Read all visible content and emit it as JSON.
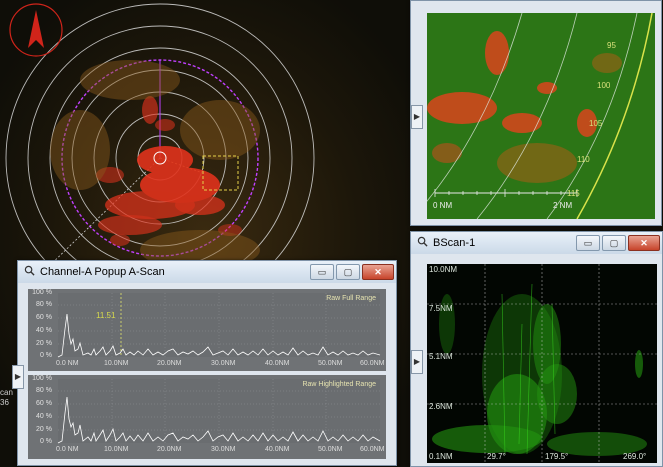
{
  "ppi": {
    "corner_labels": [
      "can",
      "36"
    ]
  },
  "ppi_zoom": {
    "range_labels": [
      "95",
      "100",
      "105",
      "110",
      "115"
    ],
    "scale_start": "0 NM",
    "scale_end": "2 NM"
  },
  "ascan_window": {
    "title": "Channel-A Popup A-Scan",
    "min_label": "▭",
    "max_label": "▢",
    "close_label": "✕",
    "top_plot": {
      "range_label": "Raw Full Range",
      "cursor_value": "11.51",
      "y_ticks": [
        "100 %",
        "80 %",
        "60 %",
        "40 %",
        "20 %",
        "0 %"
      ],
      "x_ticks": [
        "0.0 NM",
        "10.0NM",
        "20.0NM",
        "30.0NM",
        "40.0NM",
        "50.0NM",
        "60.0NM"
      ]
    },
    "bottom_plot": {
      "range_label": "Raw Highlighted Range",
      "y_ticks": [
        "100 %",
        "80 %",
        "60 %",
        "40 %",
        "20 %",
        "0 %"
      ],
      "x_ticks": [
        "0.0 NM",
        "10.0NM",
        "20.0NM",
        "30.0NM",
        "40.0NM",
        "50.0NM",
        "60.0NM"
      ]
    }
  },
  "bscan_window": {
    "title": "BScan-1",
    "min_label": "▭",
    "max_label": "▢",
    "close_label": "✕",
    "y_labels": [
      "10.0NM",
      "7.5NM",
      "5.1NM",
      "2.6NM",
      "0.1NM"
    ],
    "x_labels": [
      "29.7°",
      "179.5°",
      "269.0°"
    ]
  },
  "colors": {
    "radar_red": "#e0321c",
    "ppi_green": "#2f7a14",
    "bscan_green": "#35d51a",
    "range_ring": "#d9d9d9",
    "sweep_circle": "#c040ff"
  },
  "icons": {
    "north_arrow": "north-arrow-icon",
    "magnifier": "magnifier-icon",
    "expand_tab": "expand-arrow-icon"
  }
}
